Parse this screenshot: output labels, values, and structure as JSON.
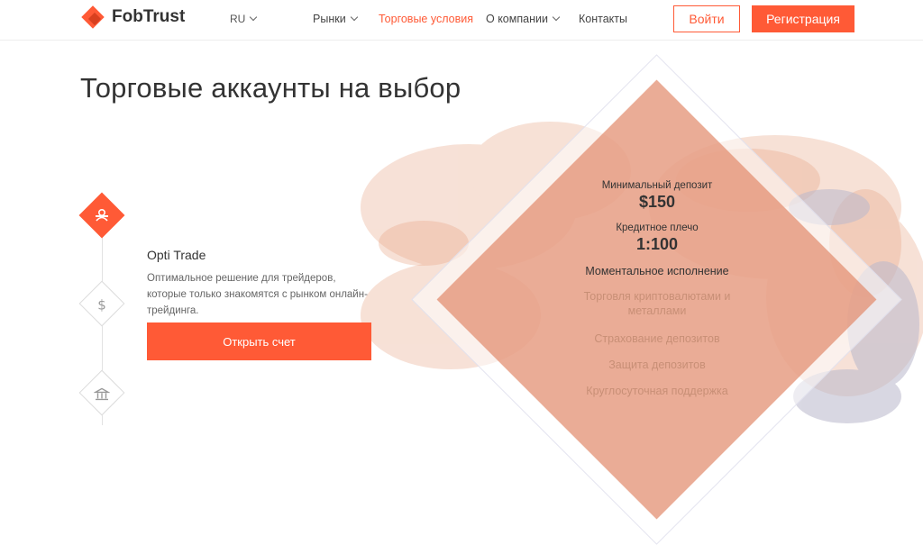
{
  "header": {
    "logo_text": "FobTrust",
    "lang": "RU",
    "nav": [
      "Рынки",
      "Торговые условия",
      "О компании",
      "Контакты"
    ],
    "login": "Войти",
    "register": "Регистрация"
  },
  "page_title": "Торговые аккаунты на выбор",
  "account": {
    "title": "Opti Trade",
    "description": "Оптимальное решение для трейдеров, которые только знакомятся с рынком онлайн-трейдинга.",
    "open_button": "Открыть счет"
  },
  "card": {
    "min_deposit_label": "Минимальный депозит",
    "min_deposit_value": "$150",
    "leverage_label": "Кредитное плечо",
    "leverage_value": "1:100",
    "features": [
      "Моментальное исполнение",
      "Торговля криптовалютами и металлами",
      "Страхование депозитов",
      "Защита депозитов",
      "Круглосуточная поддержка"
    ]
  },
  "colors": {
    "accent": "#ff5a36",
    "card": "#e28c6e"
  },
  "icons": [
    "user-icon",
    "dollar-icon",
    "bank-icon"
  ]
}
